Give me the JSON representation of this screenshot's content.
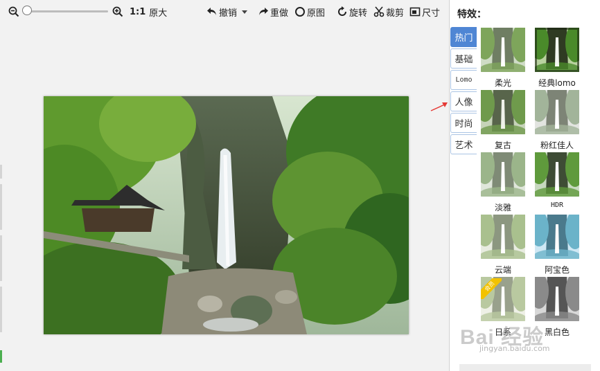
{
  "toolbar": {
    "zoom_ratio": "1:1",
    "original_size": "原大",
    "undo": "撤销",
    "redo": "重做",
    "original": "原图",
    "rotate": "旋转",
    "crop": "裁剪",
    "size": "尺寸",
    "zoom_level": 0
  },
  "panel": {
    "title": "特效：",
    "tabs": [
      {
        "label": "热门",
        "active": true
      },
      {
        "label": "基础"
      },
      {
        "label": "Lomo"
      },
      {
        "label": "人像"
      },
      {
        "label": "时尚"
      },
      {
        "label": "艺术"
      }
    ],
    "effects": [
      {
        "label": "柔光",
        "tone": "soft"
      },
      {
        "label": "经典lomo",
        "tone": "lomo"
      },
      {
        "label": "复古",
        "tone": "retro"
      },
      {
        "label": "粉红佳人",
        "tone": "pink"
      },
      {
        "label": "淡雅",
        "tone": "pale"
      },
      {
        "label": "HDR",
        "tone": "hdr"
      },
      {
        "label": "云端",
        "tone": "cloud"
      },
      {
        "label": "阿宝色",
        "tone": "abao"
      },
      {
        "label": "日系",
        "tone": "japan",
        "badge": "会员"
      },
      {
        "label": "黑白色",
        "tone": "bw"
      }
    ]
  },
  "watermark": {
    "brand": "Bai 经验",
    "url": "jingyan.baidu.com"
  },
  "colors": {
    "accent": "#4f86d4",
    "arrow": "#e53935"
  }
}
